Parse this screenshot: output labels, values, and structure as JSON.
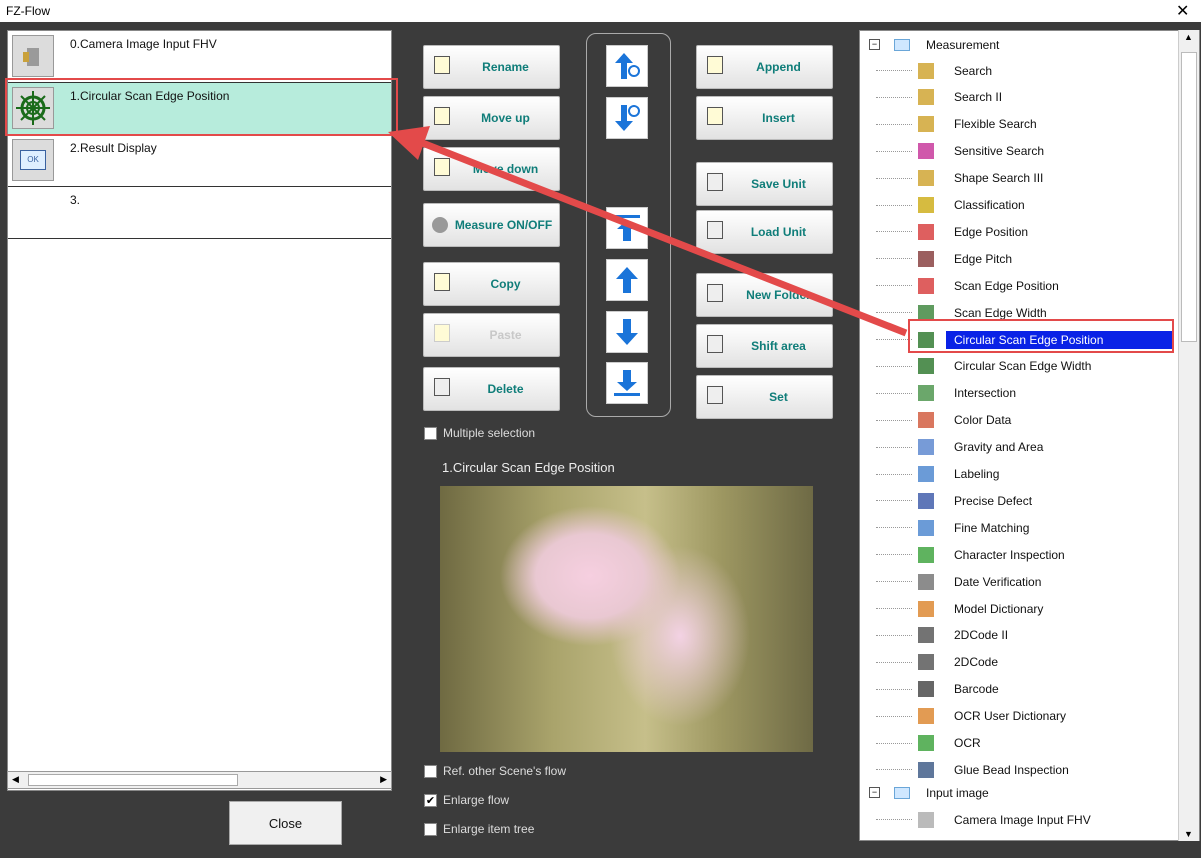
{
  "window": {
    "title": "FZ-Flow"
  },
  "flow": {
    "items": [
      {
        "label": "0.Camera Image Input FHV",
        "icon": "camera-icon"
      },
      {
        "label": "1.Circular Scan Edge Position",
        "icon": "circular-scan-icon"
      },
      {
        "label": "2.Result Display",
        "icon": "ok-display-icon"
      },
      {
        "label": "3."
      }
    ],
    "close_label": "Close"
  },
  "buttons": {
    "rename": "Rename",
    "move_up": "Move up",
    "move_down": "Move down",
    "measure": "Measure ON/OFF",
    "copy": "Copy",
    "paste": "Paste",
    "delete": "Delete",
    "append": "Append",
    "insert": "Insert",
    "save_unit": "Save Unit",
    "load_unit": "Load Unit",
    "new_folder": "New Folder",
    "shift_area": "Shift area",
    "set": "Set"
  },
  "checkboxes": {
    "multiple": "Multiple selection",
    "ref_scene": "Ref. other Scene's flow",
    "enlarge_flow": "Enlarge flow",
    "enlarge_tree": "Enlarge item tree"
  },
  "preview": {
    "title": "1.Circular Scan Edge Position"
  },
  "tree": {
    "folder_measurement": "Measurement",
    "folder_input": "Input image",
    "items": [
      "Search",
      "Search II",
      "Flexible Search",
      "Sensitive Search",
      "Shape Search III",
      "Classification",
      "Edge Position",
      "Edge Pitch",
      "Scan Edge Position",
      "Scan Edge Width",
      "Circular Scan Edge Position",
      "Circular Scan Edge Width",
      "Intersection",
      "Color Data",
      "Gravity and Area",
      "Labeling",
      "Precise Defect",
      "Fine Matching",
      "Character Inspection",
      "Date Verification",
      "Model Dictionary",
      "2DCode II",
      "2DCode",
      "Barcode",
      "OCR User Dictionary",
      "OCR",
      "Glue Bead Inspection"
    ],
    "input_items": [
      "Camera Image Input FHV"
    ]
  },
  "colors": {
    "selection_blue": "#0a22e6",
    "annotation_red": "#e34a4a",
    "flow_selected": "#b7ecdc"
  }
}
